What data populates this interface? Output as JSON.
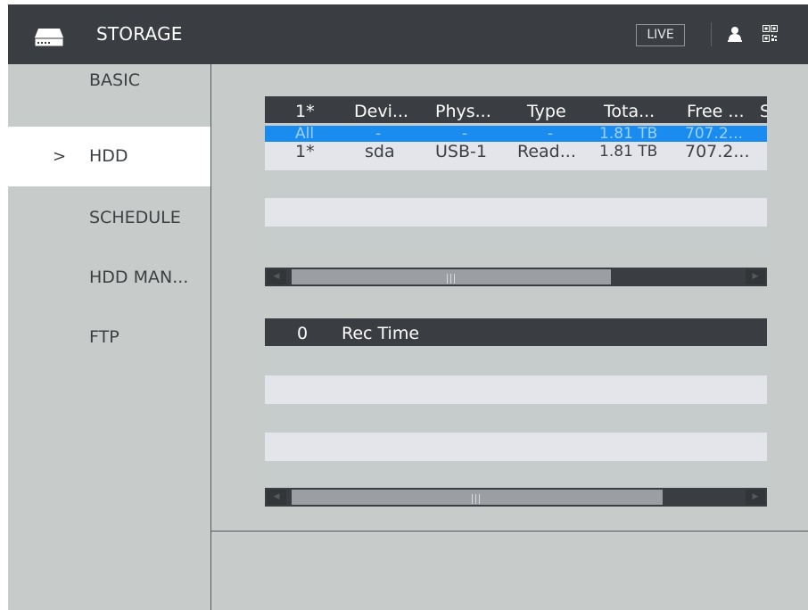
{
  "header": {
    "title": "STORAGE",
    "live_label": "LIVE",
    "icons": [
      "hdd-storage-icon",
      "user-icon",
      "qr-code-icon"
    ]
  },
  "sidebar": {
    "items": [
      {
        "label": "BASIC",
        "active": false
      },
      {
        "label": "HDD",
        "active": true,
        "indicator": ">"
      },
      {
        "label": "SCHEDULE",
        "active": false
      },
      {
        "label": "HDD MAN...",
        "active": false
      },
      {
        "label": "FTP",
        "active": false
      }
    ]
  },
  "hdd_table": {
    "headers": [
      "1*",
      "Devi...",
      "Phys...",
      "Type",
      "Tota...",
      "Free ...",
      "S"
    ],
    "rows": [
      {
        "cells": [
          "All",
          "-",
          "-",
          "-",
          "1.81 TB",
          "707.2..."
        ],
        "selected": true
      },
      {
        "cells": [
          "1*",
          "sda",
          "USB-1",
          "Read...",
          "1.81 TB",
          "707.2..."
        ],
        "selected": false
      }
    ]
  },
  "rec_table": {
    "headers": [
      "0",
      "Rec Time"
    ],
    "rows": []
  },
  "colors": {
    "header_bg": "#3a3d42",
    "body_bg": "#c7cccb",
    "selected_row": "#1a8cf0",
    "row_light": "#e3e5ea",
    "active_side_bg": "#ffffff"
  }
}
